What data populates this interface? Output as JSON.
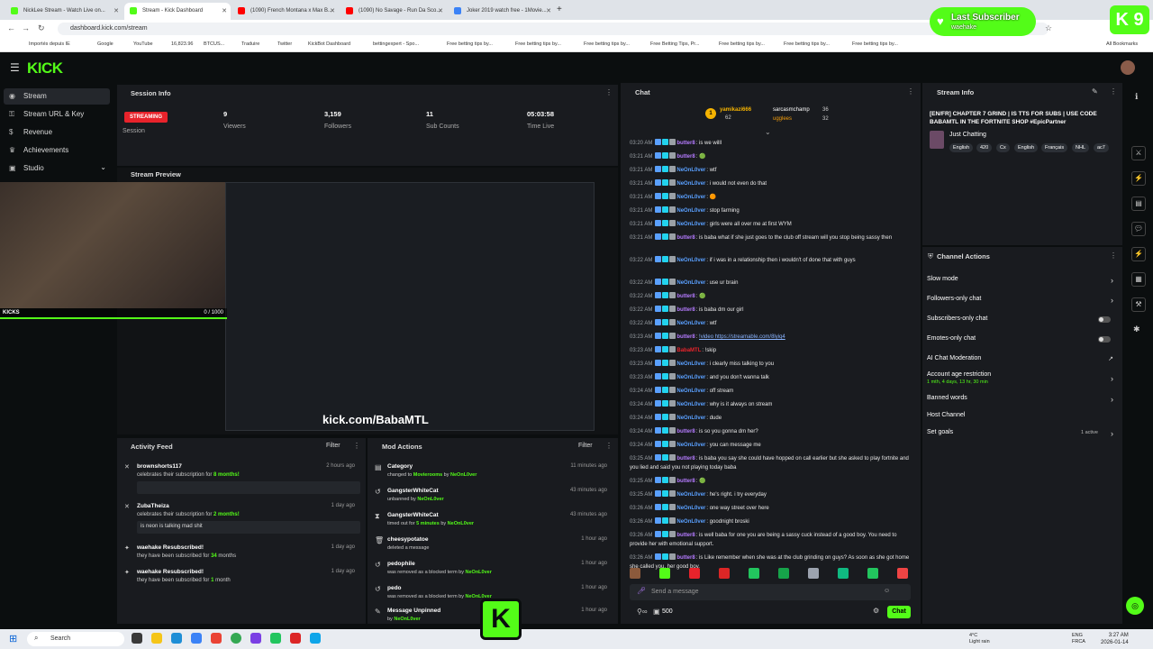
{
  "browser": {
    "tabs": [
      {
        "label": "NickLee Stream - Watch Live on...",
        "color": "#53fc18"
      },
      {
        "label": "Stream - Kick Dashboard",
        "color": "#53fc18"
      },
      {
        "label": "(1090) French Montana x Max B...",
        "color": "#ff0000"
      },
      {
        "label": "(1090) No Savage - Run Da Sco...",
        "color": "#ff0000"
      },
      {
        "label": "Joker 2019 watch free - 1Movie...",
        "color": "#3b82f6"
      }
    ],
    "url": "dashboard.kick.com/stream",
    "bookmarks": [
      "Importés depuis IE",
      "Google",
      "YouTube",
      "16,823.96",
      "BTCUS...",
      "Traduire",
      "Twitter",
      "KickBot Dashboard",
      "bettingexpert - Spo...",
      "Free betting tips by...",
      "Free betting tips by...",
      "Free betting tips by...",
      "Free Betting Tips, Pr...",
      "Free betting tips by...",
      "Free betting tips by...",
      "Free betting tips by...",
      "All Bookmarks"
    ]
  },
  "overlay": {
    "last_subscriber_title": "Last Subscriber",
    "last_subscriber_name": "waehake",
    "kick_tile": "K 9"
  },
  "app": {
    "logo": "KICK"
  },
  "sidebar": {
    "items": [
      {
        "label": "Stream",
        "icon": "broadcast-icon"
      },
      {
        "label": "Stream URL & Key",
        "icon": "key-icon"
      },
      {
        "label": "Revenue",
        "icon": "dollar-icon"
      },
      {
        "label": "Achievements",
        "icon": "trophy-icon"
      },
      {
        "label": "Studio",
        "icon": "studio-icon"
      }
    ]
  },
  "session": {
    "title": "Session Info",
    "status": "STREAMING",
    "stats": [
      {
        "value": "",
        "label": "Session"
      },
      {
        "value": "9",
        "label": "Viewers"
      },
      {
        "value": "3,159",
        "label": "Followers"
      },
      {
        "value": "11",
        "label": "Sub Counts"
      },
      {
        "value": "05:03:58",
        "label": "Time Live"
      }
    ]
  },
  "preview": {
    "title": "Stream Preview",
    "kicks_label": "KICKS",
    "kicks_progress": "0 / 1000",
    "watermark": "kick.com/BabaMTL"
  },
  "activity": {
    "title": "Activity Feed",
    "filter": "Filter",
    "items": [
      {
        "name": "brownshorts117",
        "text_pre": "celebrates their subscription for ",
        "highlight": "8 months!",
        "time": "2 hours ago"
      },
      {
        "name": "ZubaTheiza",
        "text_pre": "celebrates their subscription for ",
        "highlight": "2 months!",
        "time": "1 day ago"
      },
      {
        "name": "waehake Resubscribed!",
        "text_pre": "they have been subscribed for ",
        "highlight": "34",
        "text_post": " months",
        "time": "1 day ago"
      },
      {
        "name": "waehake Resubscribed!",
        "text_pre": "they have been subscribed for ",
        "highlight": "1",
        "text_post": " month",
        "time": "1 day ago"
      }
    ],
    "note": "is neon is talking mad shit"
  },
  "mod": {
    "title": "Mod Actions",
    "filter": "Filter",
    "items": [
      {
        "title": "Category",
        "sub_pre": "changed to ",
        "hl1": "Movierooms",
        "sub_mid": " by ",
        "hl2": "NeOnL0ver",
        "time": "11 minutes ago"
      },
      {
        "title": "GangsterWhiteCat",
        "sub_pre": "unbanned by ",
        "hl1": "NeOnL0ver",
        "sub_mid": "",
        "hl2": "",
        "time": "43 minutes ago"
      },
      {
        "title": "GangsterWhiteCat",
        "sub_pre": "timed out for ",
        "hl1": "5 minutes",
        "sub_mid": " by ",
        "hl2": "NeOnL0ver",
        "time": "43 minutes ago"
      },
      {
        "title": "cheesypotatoe",
        "sub_pre": "deleted a message",
        "hl1": "",
        "sub_mid": "",
        "hl2": "",
        "time": "1 hour ago"
      },
      {
        "title": "pedophile",
        "sub_pre": "was removed as a blocked term by ",
        "hl1": "NeOnL0ver",
        "sub_mid": "",
        "hl2": "",
        "time": "1 hour ago"
      },
      {
        "title": "pedo",
        "sub_pre": "was removed as a blocked term by ",
        "hl1": "NeOnL0ver",
        "sub_mid": "",
        "hl2": "",
        "time": "1 hour ago"
      },
      {
        "title": "Message Unpinned",
        "sub_pre": "by ",
        "hl1": "NeOnL0ver",
        "sub_mid": "",
        "hl2": "",
        "time": "1 hour ago"
      }
    ]
  },
  "chat": {
    "title": "Chat",
    "gifters": [
      {
        "name": "yamikazi666",
        "count": "62"
      },
      {
        "name": "sarcasmchamp",
        "count": "36"
      },
      {
        "name": "ugglees",
        "count": "32"
      }
    ],
    "messages": [
      {
        "time": "03:20 AM",
        "user": "butter8",
        "color": "#b57bff",
        "text": "is we willl"
      },
      {
        "time": "03:21 AM",
        "user": "butter8",
        "color": "#b57bff",
        "text": "🟢"
      },
      {
        "time": "03:21 AM",
        "user": "NeOnL0ver",
        "color": "#5aa0ff",
        "text": "wtf"
      },
      {
        "time": "03:21 AM",
        "user": "NeOnL0ver",
        "color": "#5aa0ff",
        "text": "i would not even do that"
      },
      {
        "time": "03:21 AM",
        "user": "NeOnL0ver",
        "color": "#5aa0ff",
        "text": "🟠"
      },
      {
        "time": "03:21 AM",
        "user": "NeOnL0ver",
        "color": "#5aa0ff",
        "text": "stop farming"
      },
      {
        "time": "03:21 AM",
        "user": "NeOnL0ver",
        "color": "#5aa0ff",
        "text": "girls were all over me at first WYM"
      },
      {
        "time": "03:21 AM",
        "user": "butter8",
        "color": "#b57bff",
        "text": "is baba what if she just goes to the club off stream will you stop being sassy then"
      },
      {
        "time": "03:22 AM",
        "user": "NeOnL0ver",
        "color": "#5aa0ff",
        "text": "if i was in a relationship then i wouldn't of done that with guys"
      },
      {
        "time": "03:22 AM",
        "user": "NeOnL0ver",
        "color": "#5aa0ff",
        "text": "use ur brain"
      },
      {
        "time": "03:22 AM",
        "user": "butter8",
        "color": "#b57bff",
        "text": "🟢"
      },
      {
        "time": "03:22 AM",
        "user": "butter8",
        "color": "#b57bff",
        "text": "is baba dm our girl"
      },
      {
        "time": "03:22 AM",
        "user": "NeOnL0ver",
        "color": "#5aa0ff",
        "text": "wtf"
      },
      {
        "time": "03:23 AM",
        "user": "butter8",
        "color": "#b57bff",
        "text": "!video https://streamable.com/8lyiq4"
      },
      {
        "time": "03:23 AM",
        "user": "BabaMTL",
        "color": "#e8232b",
        "text": "!skip"
      },
      {
        "time": "03:23 AM",
        "user": "NeOnL0ver",
        "color": "#5aa0ff",
        "text": "i clearly miss talking to you"
      },
      {
        "time": "03:23 AM",
        "user": "NeOnL0ver",
        "color": "#5aa0ff",
        "text": "and you don't wanna talk"
      },
      {
        "time": "03:24 AM",
        "user": "NeOnL0ver",
        "color": "#5aa0ff",
        "text": "off stream"
      },
      {
        "time": "03:24 AM",
        "user": "NeOnL0ver",
        "color": "#5aa0ff",
        "text": "why is it always on stream"
      },
      {
        "time": "03:24 AM",
        "user": "NeOnL0ver",
        "color": "#5aa0ff",
        "text": "dude"
      },
      {
        "time": "03:24 AM",
        "user": "butter8",
        "color": "#b57bff",
        "text": "is so you gonna dm her?"
      },
      {
        "time": "03:24 AM",
        "user": "NeOnL0ver",
        "color": "#5aa0ff",
        "text": "you can message me"
      },
      {
        "time": "03:25 AM",
        "user": "butter8",
        "color": "#b57bff",
        "text": "is baba you say she could have hopped on call earlier but she asked to play fortnite and you lied and said you not playing today baba"
      },
      {
        "time": "03:25 AM",
        "user": "butter8",
        "color": "#b57bff",
        "text": "🟢"
      },
      {
        "time": "03:25 AM",
        "user": "NeOnL0ver",
        "color": "#5aa0ff",
        "text": "he's right. i try everyday"
      },
      {
        "time": "03:26 AM",
        "user": "NeOnL0ver",
        "color": "#5aa0ff",
        "text": "one way street over here"
      },
      {
        "time": "03:26 AM",
        "user": "NeOnL0ver",
        "color": "#5aa0ff",
        "text": "goodnight broski"
      },
      {
        "time": "03:26 AM",
        "user": "butter8",
        "color": "#b57bff",
        "text": "is well baba for one you are being a sassy cuck instead of a good boy. You need to provide her with emotional support."
      },
      {
        "time": "03:26 AM",
        "user": "butter8",
        "color": "#b57bff",
        "text": "is Like remember when she was at the club grinding on guys? As soon as she got home she called you, her good boy."
      }
    ],
    "input_placeholder": "Send a message",
    "kicks_count": "500",
    "send_label": "Chat"
  },
  "stream_info": {
    "title": "Stream Info",
    "stream_title": "[EN/FR] CHAPTER 7 GRIND | IS TTS FOR SUBS | USE CODE BABAMTL IN THE FORTNITE SHOP #EpicPartner",
    "category": "Just Chatting",
    "tags": [
      "English",
      "420",
      "Cx",
      "English",
      "Français",
      "NHL",
      "ac7"
    ]
  },
  "channel_actions": {
    "title": "Channel Actions",
    "items": [
      {
        "label": "Slow mode",
        "kind": "chevron"
      },
      {
        "label": "Followers-only chat",
        "kind": "chevron"
      },
      {
        "label": "Subscribers-only chat",
        "kind": "toggle"
      },
      {
        "label": "Emotes-only chat",
        "kind": "toggle"
      },
      {
        "label": "AI Chat Moderation",
        "kind": "external"
      },
      {
        "label": "Account age restriction",
        "sub": "1 mth, 4 days, 13 hr, 30 min",
        "kind": "chevron"
      },
      {
        "label": "Banned words",
        "kind": "chevron"
      },
      {
        "label": "Host Channel",
        "kind": "none"
      },
      {
        "label": "Set goals",
        "sub_right": "1 active",
        "kind": "chevron"
      }
    ]
  },
  "taskbar": {
    "search": "Search",
    "weather": "4°C\nLight rain",
    "lang": "ENG\nFRCA",
    "time": "3:27 AM",
    "date": "2026-01-14"
  }
}
